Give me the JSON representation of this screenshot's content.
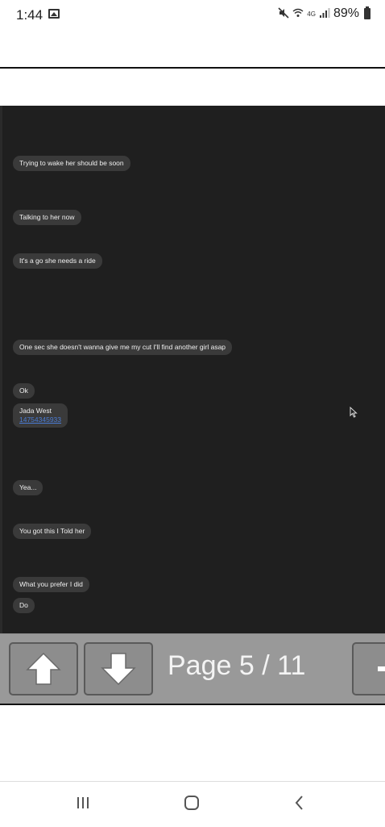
{
  "status": {
    "time": "1:44",
    "network": "4G",
    "battery": "89%"
  },
  "messages": [
    "Trying to wake her should be soon",
    "Talking to her now",
    "It's a go she needs a ride",
    "One sec she doesn't wanna give me my cut I'll find another girl asap",
    "Ok",
    "Yea...",
    "You got this I Told her",
    "What you prefer I did",
    "Do"
  ],
  "contact_card": {
    "name": "Jada West",
    "phone": "14754345933"
  },
  "toolbar": {
    "page_label": "Page 5 / 11"
  },
  "icons": [
    "gallery-icon",
    "mute-icon",
    "wifi-icon",
    "signal-icon",
    "battery-icon",
    "cursor-icon",
    "up-arrow-icon",
    "down-arrow-icon",
    "minus-icon",
    "recent-apps-icon",
    "home-icon",
    "back-icon"
  ]
}
